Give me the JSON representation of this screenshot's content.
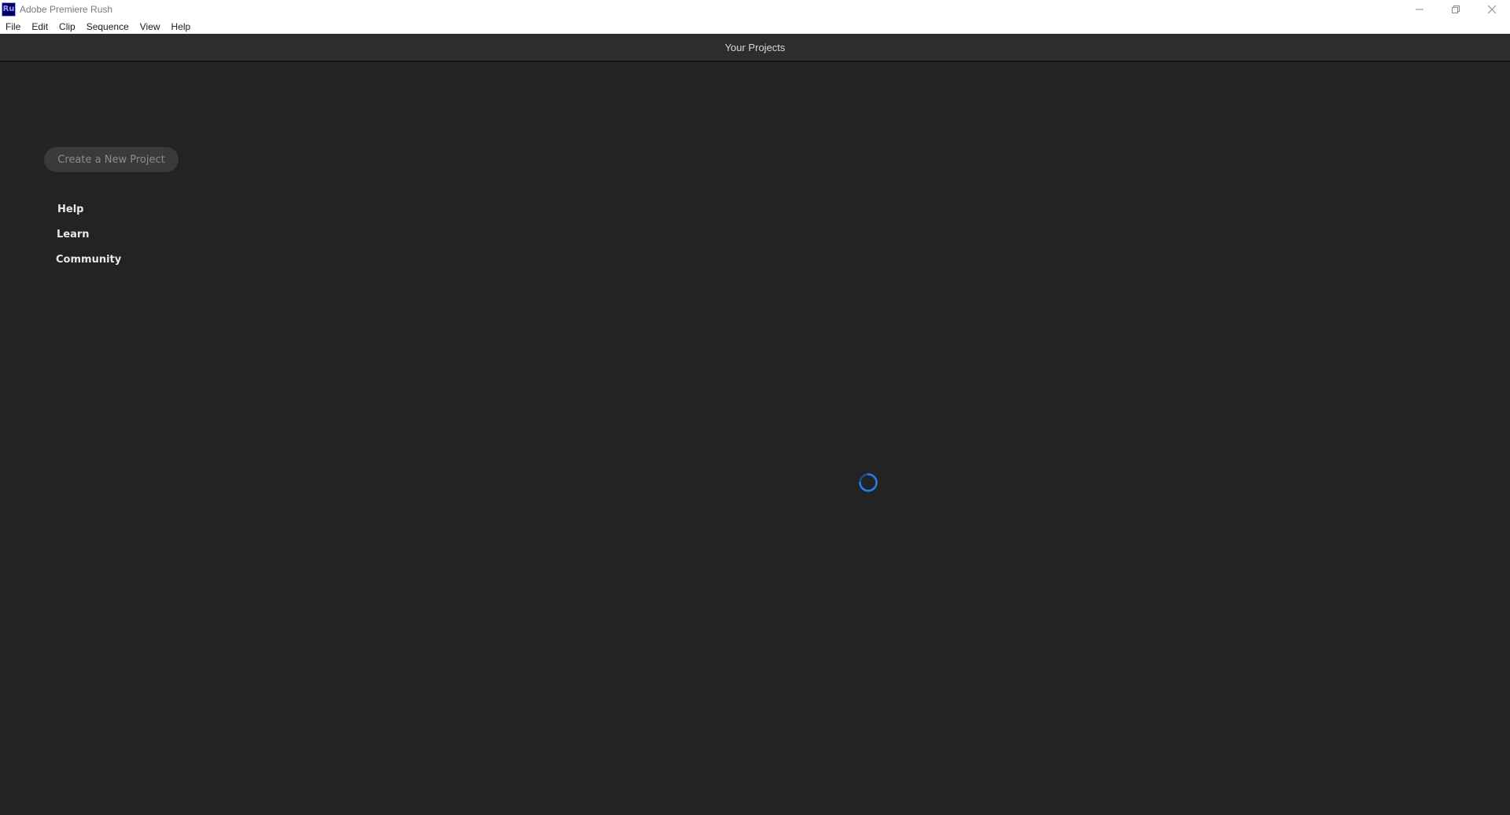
{
  "window": {
    "icon_text": "Ru",
    "title": "Adobe Premiere Rush",
    "controls": [
      "minimize-icon",
      "restore-icon",
      "close-icon"
    ]
  },
  "menu": {
    "items": [
      "File",
      "Edit",
      "Clip",
      "Sequence",
      "View",
      "Help"
    ]
  },
  "header": {
    "title": "Your Projects"
  },
  "sidebar": {
    "new_project_label": "Create a New Project",
    "links": [
      "Help",
      "Learn",
      "Community"
    ]
  },
  "main": {
    "loading_icon": "spinner-icon"
  },
  "colors": {
    "background": "#232323",
    "header_bg": "#2d2d2d",
    "spinner": "#2680eb",
    "app_icon_bg": "#00005b",
    "app_icon_fg": "#9999ff"
  }
}
